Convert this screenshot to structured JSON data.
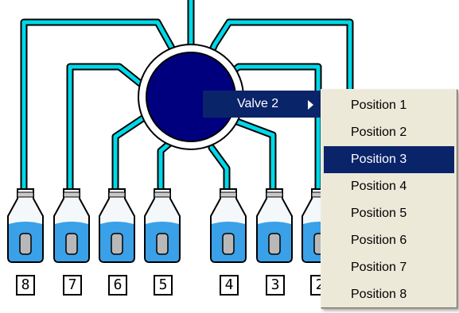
{
  "colors": {
    "tube": "#00d8e8",
    "valve": "#00007f",
    "liquid": "#3aa0e8",
    "menu_bg": "#ece9d8",
    "highlight": "#0a246a"
  },
  "bottles": [
    {
      "label": "8"
    },
    {
      "label": "7"
    },
    {
      "label": "6"
    },
    {
      "label": "5"
    },
    {
      "label": "4"
    },
    {
      "label": "3"
    },
    {
      "label": "2"
    }
  ],
  "context_menu": {
    "item": "Valve 2",
    "submenu": [
      {
        "label": "Position 1"
      },
      {
        "label": "Position 2"
      },
      {
        "label": "Position 3",
        "selected": true
      },
      {
        "label": "Position 4"
      },
      {
        "label": "Position 5"
      },
      {
        "label": "Position 6"
      },
      {
        "label": "Position 7"
      },
      {
        "label": "Position 8"
      }
    ]
  }
}
